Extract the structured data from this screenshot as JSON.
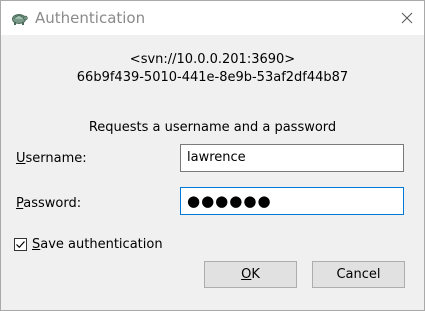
{
  "window": {
    "title": "Authentication"
  },
  "realm": {
    "url": "<svn://10.0.0.201:3690>",
    "uuid": "66b9f439-5010-441e-8e9b-53af2df44b87"
  },
  "prompt": "Requests a username and a password",
  "fields": {
    "username_label_mnemonic": "U",
    "username_label_rest": "sername:",
    "username_value": "lawrence",
    "password_label_mnemonic": "P",
    "password_label_rest": "assword:",
    "password_value": "●●●●●●"
  },
  "save_auth": {
    "checked": true,
    "label_mnemonic": "S",
    "label_rest": "ave authentication"
  },
  "buttons": {
    "ok_mnemonic": "O",
    "ok_rest": "K",
    "cancel_label": "Cancel"
  },
  "icons": {
    "app": "tortoise-icon",
    "close": "close-icon",
    "check": "checkmark-icon"
  }
}
